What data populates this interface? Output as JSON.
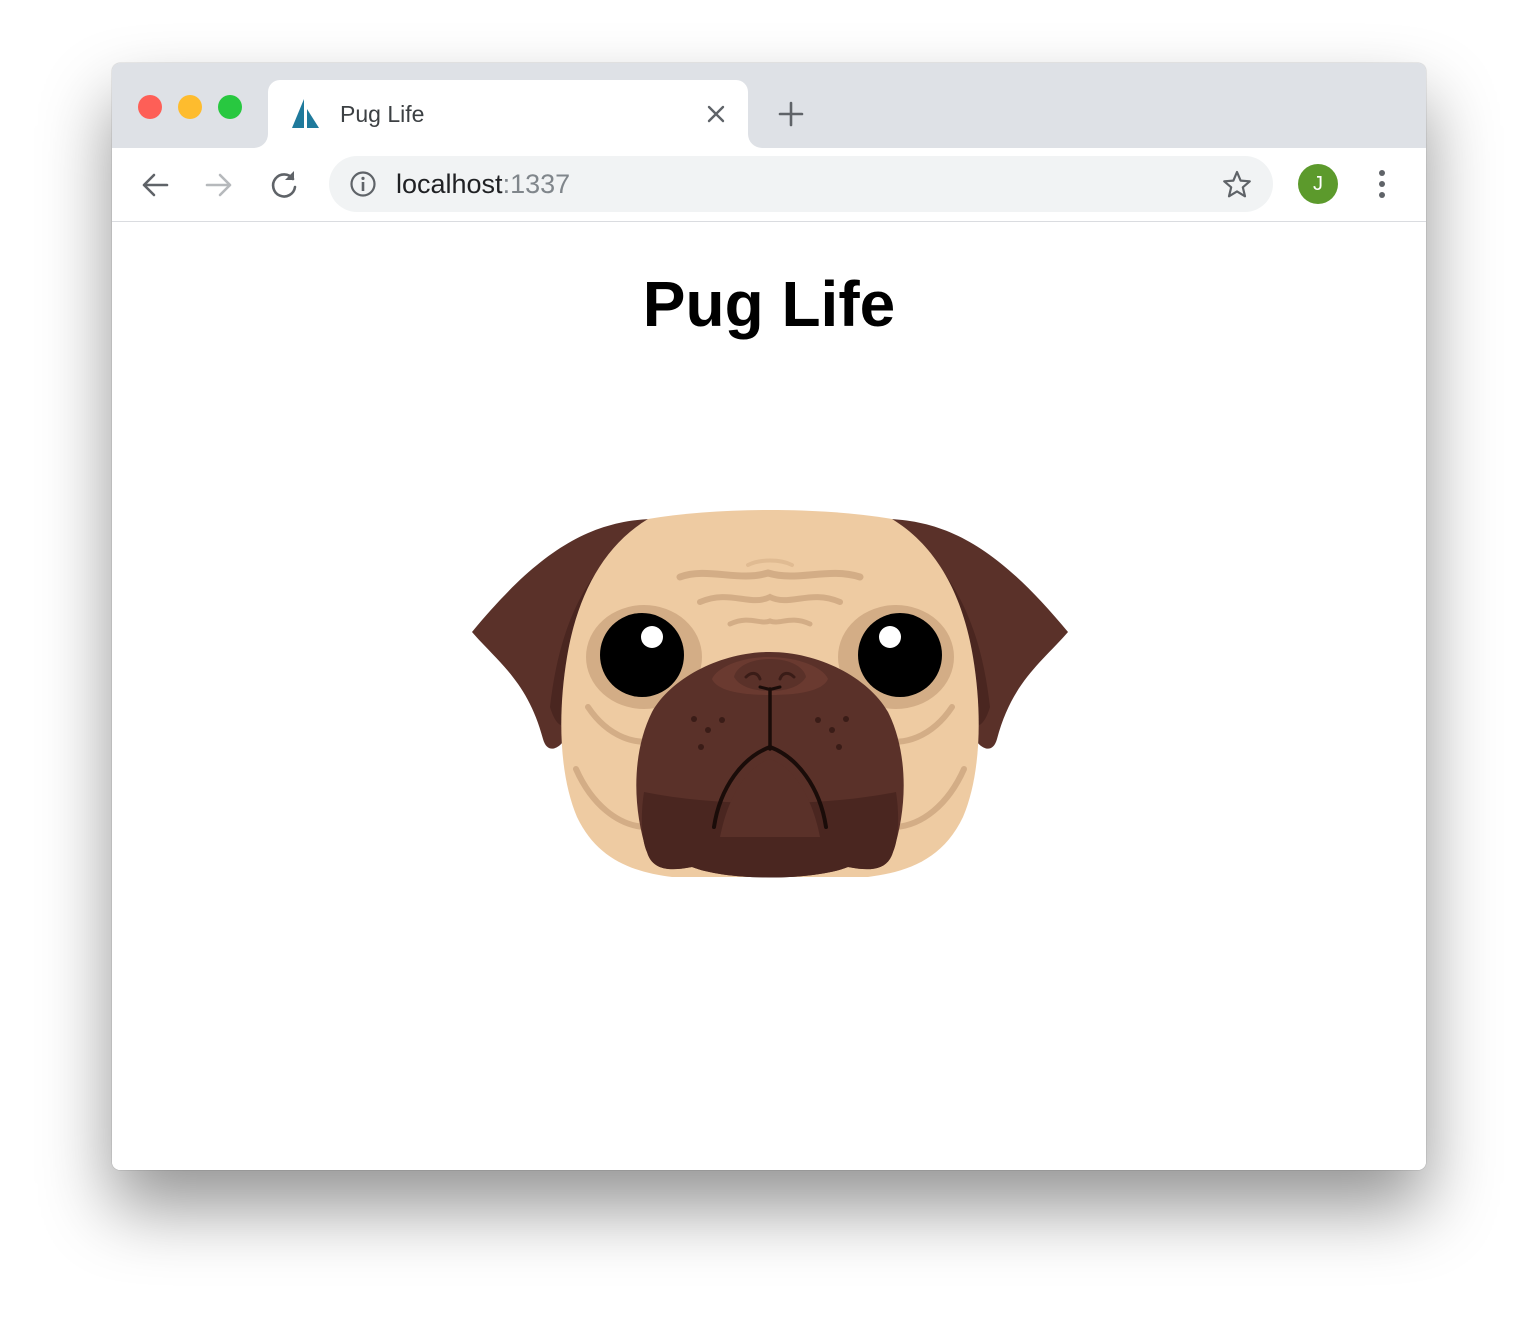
{
  "browser": {
    "tab": {
      "title": "Pug Life",
      "favicon": "sailboat-icon"
    },
    "toolbar": {
      "address_host": "localhost",
      "address_port": ":1337",
      "profile_initial": "J"
    },
    "icons": {
      "back": "arrow-left-icon",
      "forward": "arrow-right-icon",
      "reload": "reload-icon",
      "info": "info-icon",
      "bookmark": "star-icon",
      "menu": "vertical-dots-icon",
      "close_tab": "close-icon",
      "new_tab": "plus-icon"
    },
    "colors": {
      "titlebar": "#dee1e6",
      "close_light": "#fe5f57",
      "minimize_light": "#febc2e",
      "maximize_light": "#28c840",
      "avatar": "#5c9a2c",
      "favicon": "#1f7a9c"
    }
  },
  "page": {
    "heading": "Pug Life",
    "illustration": "pug-face",
    "colors": {
      "fawn": "#eecba2",
      "fawn_shadow": "#d3ad86",
      "mask": "#5a3129",
      "mask_dark": "#4a2620"
    }
  }
}
